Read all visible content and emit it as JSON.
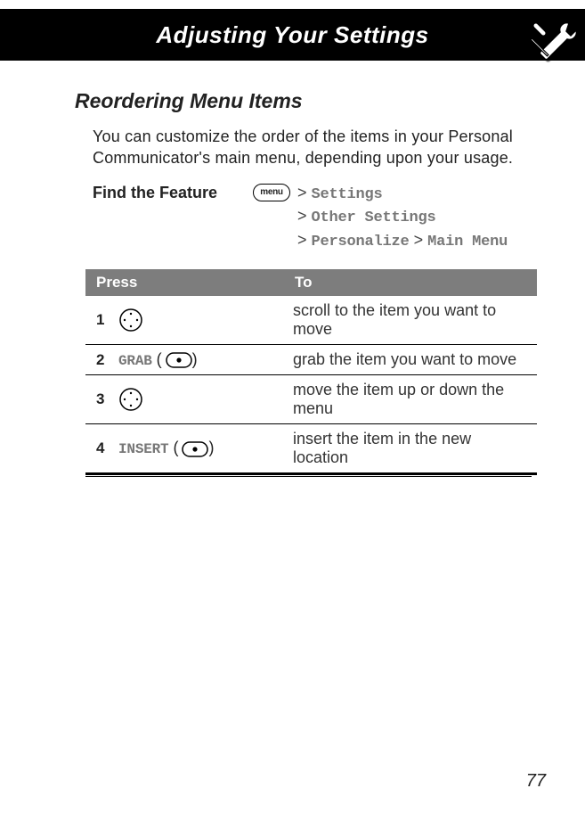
{
  "header": {
    "title": "Adjusting Your Settings"
  },
  "section": {
    "heading": "Reordering Menu Items",
    "intro": "You can customize the order of the items in your Personal Communicator's main menu, depending upon your usage."
  },
  "find": {
    "label": "Find the Feature",
    "menu_key": "menu",
    "path": [
      "Settings",
      "Other Settings",
      "Personalize",
      "Main Menu"
    ]
  },
  "table": {
    "headers": [
      "Press",
      "To"
    ],
    "rows": [
      {
        "num": "1",
        "press": "",
        "icon": "nav-wheel",
        "to": "scroll to the item you want to move"
      },
      {
        "num": "2",
        "press": "GRAB",
        "icon": "center-dot",
        "to": "grab the item you want to move"
      },
      {
        "num": "3",
        "press": "",
        "icon": "nav-wheel",
        "to": "move the item up or down the menu"
      },
      {
        "num": "4",
        "press": "INSERT",
        "icon": "center-dot",
        "to": "insert the item in the new location"
      }
    ]
  },
  "page_number": "77"
}
